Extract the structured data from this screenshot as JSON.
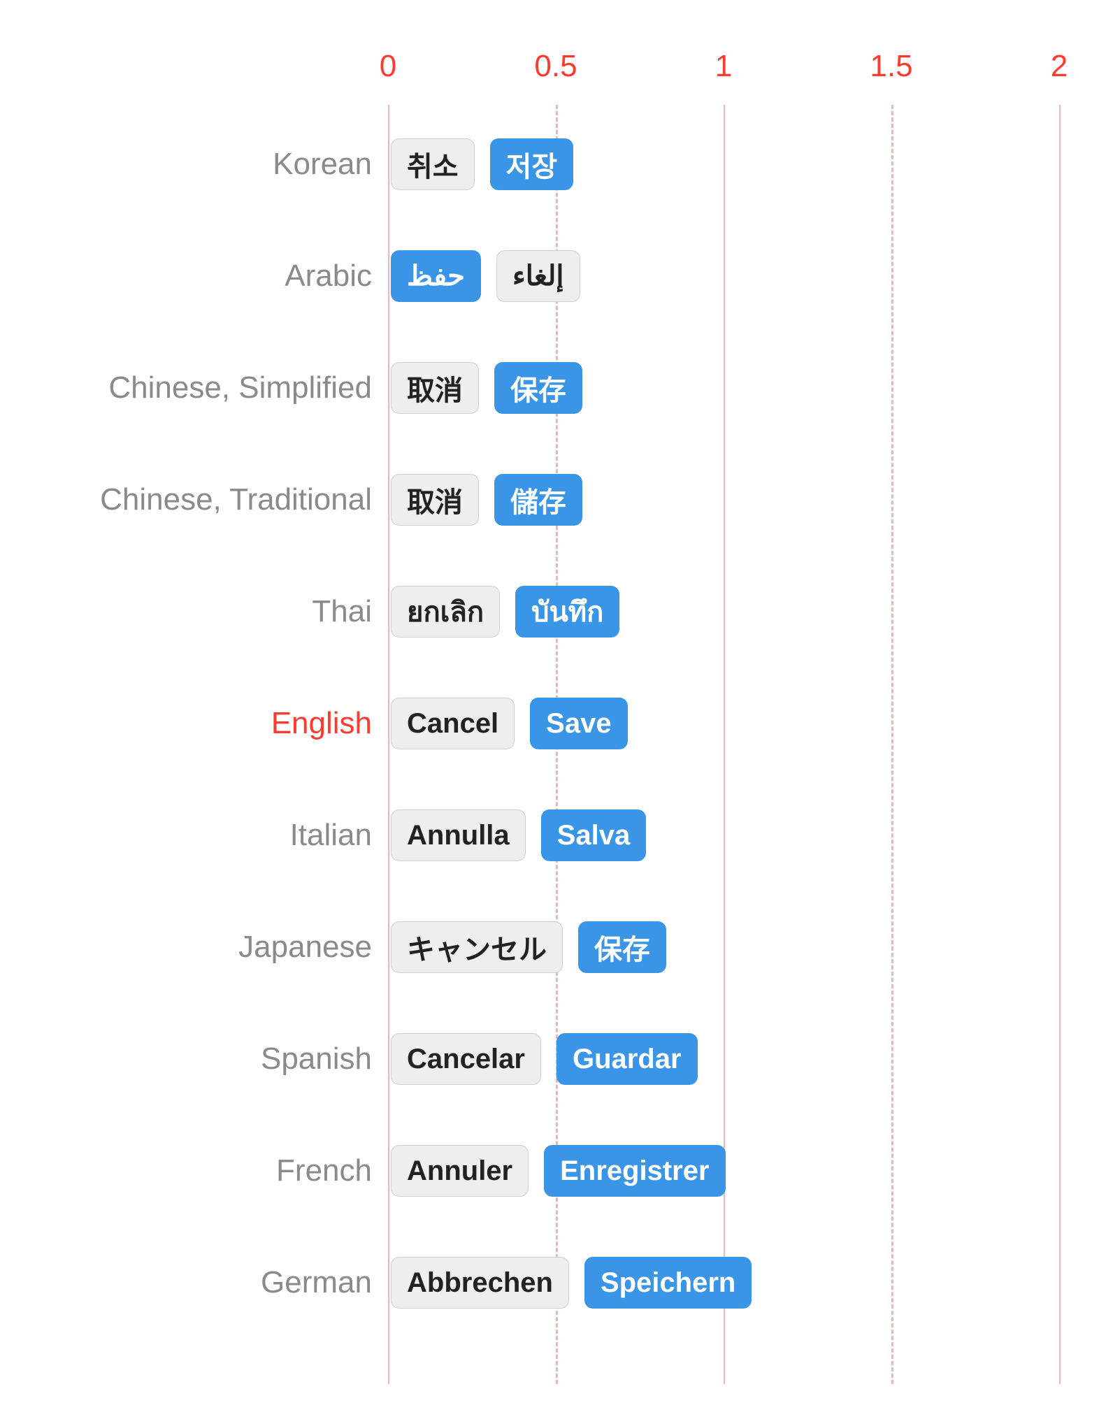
{
  "chart_data": {
    "type": "bar",
    "title": "",
    "xlabel": "",
    "ylabel": "",
    "x_ticks": [
      0,
      0.5,
      1,
      1.5,
      2
    ],
    "xlim": [
      0,
      2
    ],
    "highlight_category": "English",
    "categories": [
      "Korean",
      "Arabic",
      "Chinese, Simplified",
      "Chinese, Traditional",
      "Thai",
      "English",
      "Italian",
      "Japanese",
      "Spanish",
      "French",
      "German"
    ],
    "series": [
      {
        "name": "Cancel",
        "values": [
          "취소",
          "حفظ",
          "取消",
          "取消",
          "ยกเลิก",
          "Cancel",
          "Annulla",
          "キャンセル",
          "Cancelar",
          "Annuler",
          "Abbrechen"
        ],
        "style": "cancel"
      },
      {
        "name": "Save",
        "values": [
          "저장",
          "إلغاء",
          "保存",
          "儲存",
          "บันทึก",
          "Save",
          "Salva",
          "保存",
          "Guardar",
          "Enregistrer",
          "Speichern"
        ],
        "style": "save"
      }
    ],
    "note": "Arabic row visually places the blue button first (RTL)."
  },
  "ticks": {
    "t0": "0",
    "t1": "0.5",
    "t2": "1",
    "t3": "1.5",
    "t4": "2"
  },
  "rows": {
    "r0": {
      "label": "Korean",
      "cancel": "취소",
      "save": "저장"
    },
    "r1": {
      "label": "Arabic",
      "cancel": "حفظ",
      "save": "إلغاء"
    },
    "r2": {
      "label": "Chinese, Simplified",
      "cancel": "取消",
      "save": "保存"
    },
    "r3": {
      "label": "Chinese, Traditional",
      "cancel": "取消",
      "save": "儲存"
    },
    "r4": {
      "label": "Thai",
      "cancel": "ยกเลิก",
      "save": "บันทึก"
    },
    "r5": {
      "label": "English",
      "cancel": "Cancel",
      "save": "Save"
    },
    "r6": {
      "label": "Italian",
      "cancel": "Annulla",
      "save": "Salva"
    },
    "r7": {
      "label": "Japanese",
      "cancel": "キャンセル",
      "save": "保存"
    },
    "r8": {
      "label": "Spanish",
      "cancel": "Cancelar",
      "save": "Guardar"
    },
    "r9": {
      "label": "French",
      "cancel": "Annuler",
      "save": "Enregistrer"
    },
    "r10": {
      "label": "German",
      "cancel": "Abbrechen",
      "save": "Speichern"
    }
  }
}
